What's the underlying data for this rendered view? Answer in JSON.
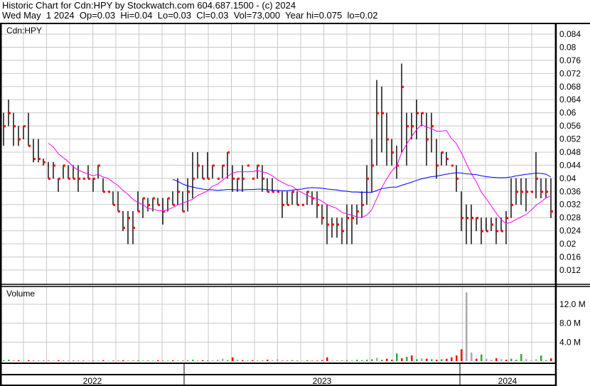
{
  "header": {
    "title": "Historic Chart for Cdn:HPY by Stockwatch.com 604.687.1500 - (c) 2024",
    "summary": "Wed May  1 2024  Op=0.03  Hi=0.04  Lo=0.03  Cl=0.03  Vol=73,000  Year hi=0.075  lo=0.02"
  },
  "colors": {
    "bar": "#000000",
    "close_tick": "#ff0000",
    "ma_short": "#ff00ff",
    "ma_long": "#0000ff",
    "vol_up": "#33aa33",
    "vol_down": "#ff0000",
    "vol_flat": "#aaaaaa",
    "grid": "#c8c8c8"
  },
  "chart_data": [
    {
      "type": "ohlc",
      "title": "Cdn:HPY",
      "y_ticks": [
        "0.084",
        "0.08",
        "0.076",
        "0.072",
        "0.068",
        "0.064",
        "0.06",
        "0.056",
        "0.052",
        "0.048",
        "0.044",
        "0.04",
        "0.036",
        "0.032",
        "0.028",
        "0.024",
        "0.02",
        "0.016",
        "0.012"
      ],
      "ylim": [
        0.0085,
        0.0875
      ],
      "ma_periods": [
        10,
        35
      ],
      "bars_hi_lo_close": [
        [
          0.06,
          0.05,
          0.056
        ],
        [
          0.064,
          0.056,
          0.06
        ],
        [
          0.06,
          0.05,
          0.056
        ],
        [
          0.056,
          0.05,
          0.052
        ],
        [
          0.056,
          0.052,
          0.056
        ],
        [
          0.06,
          0.05,
          0.05
        ],
        [
          0.052,
          0.045,
          0.046
        ],
        [
          0.052,
          0.045,
          0.046
        ],
        [
          0.046,
          0.044,
          0.045
        ],
        [
          0.045,
          0.04,
          0.04
        ],
        [
          0.045,
          0.04,
          0.044
        ],
        [
          0.04,
          0.036,
          0.04
        ],
        [
          0.044,
          0.04,
          0.044
        ],
        [
          0.044,
          0.04,
          0.04
        ],
        [
          0.044,
          0.04,
          0.04
        ],
        [
          0.044,
          0.036,
          0.04
        ],
        [
          0.04,
          0.04,
          0.04
        ],
        [
          0.044,
          0.04,
          0.04
        ],
        [
          0.04,
          0.036,
          0.04
        ],
        [
          0.044,
          0.04,
          0.044
        ],
        [
          0.04,
          0.036,
          0.036
        ],
        [
          0.036,
          0.036,
          0.036
        ],
        [
          0.036,
          0.032,
          0.032
        ],
        [
          0.036,
          0.03,
          0.03
        ],
        [
          0.03,
          0.024,
          0.025
        ],
        [
          0.03,
          0.02,
          0.028
        ],
        [
          0.03,
          0.02,
          0.025
        ],
        [
          0.036,
          0.03,
          0.03
        ],
        [
          0.034,
          0.028,
          0.034
        ],
        [
          0.034,
          0.03,
          0.032
        ],
        [
          0.034,
          0.03,
          0.034
        ],
        [
          0.034,
          0.032,
          0.032
        ],
        [
          0.034,
          0.026,
          0.03
        ],
        [
          0.034,
          0.03,
          0.034
        ],
        [
          0.036,
          0.032,
          0.032
        ],
        [
          0.04,
          0.032,
          0.036
        ],
        [
          0.036,
          0.03,
          0.03
        ],
        [
          0.04,
          0.03,
          0.036
        ],
        [
          0.048,
          0.034,
          0.04
        ],
        [
          0.048,
          0.04,
          0.044
        ],
        [
          0.044,
          0.04,
          0.04
        ],
        [
          0.048,
          0.04,
          0.04
        ],
        [
          0.044,
          0.04,
          0.044
        ],
        [
          0.04,
          0.04,
          0.04
        ],
        [
          0.044,
          0.04,
          0.044
        ],
        [
          0.048,
          0.04,
          0.048
        ],
        [
          0.044,
          0.036,
          0.04
        ],
        [
          0.04,
          0.036,
          0.04
        ],
        [
          0.044,
          0.036,
          0.04
        ],
        [
          0.044,
          0.044,
          0.044
        ],
        [
          0.04,
          0.04,
          0.04
        ],
        [
          0.044,
          0.04,
          0.044
        ],
        [
          0.044,
          0.036,
          0.04
        ],
        [
          0.04,
          0.036,
          0.036
        ],
        [
          0.04,
          0.036,
          0.036
        ],
        [
          0.036,
          0.036,
          0.036
        ],
        [
          0.036,
          0.028,
          0.032
        ],
        [
          0.036,
          0.032,
          0.032
        ],
        [
          0.036,
          0.032,
          0.036
        ],
        [
          0.036,
          0.032,
          0.032
        ],
        [
          0.032,
          0.032,
          0.032
        ],
        [
          0.036,
          0.032,
          0.036
        ],
        [
          0.036,
          0.032,
          0.034
        ],
        [
          0.036,
          0.028,
          0.032
        ],
        [
          0.032,
          0.026,
          0.028
        ],
        [
          0.032,
          0.02,
          0.026
        ],
        [
          0.028,
          0.022,
          0.026
        ],
        [
          0.028,
          0.022,
          0.026
        ],
        [
          0.028,
          0.02,
          0.024
        ],
        [
          0.032,
          0.02,
          0.028
        ],
        [
          0.032,
          0.02,
          0.028
        ],
        [
          0.032,
          0.026,
          0.03
        ],
        [
          0.036,
          0.028,
          0.032
        ],
        [
          0.044,
          0.032,
          0.04
        ],
        [
          0.052,
          0.036,
          0.044
        ],
        [
          0.07,
          0.044,
          0.06
        ],
        [
          0.068,
          0.048,
          0.06
        ],
        [
          0.06,
          0.044,
          0.052
        ],
        [
          0.052,
          0.044,
          0.048
        ],
        [
          0.05,
          0.04,
          0.044
        ],
        [
          0.075,
          0.048,
          0.068
        ],
        [
          0.06,
          0.044,
          0.056
        ],
        [
          0.06,
          0.052,
          0.056
        ],
        [
          0.064,
          0.052,
          0.06
        ],
        [
          0.06,
          0.056,
          0.06
        ],
        [
          0.06,
          0.044,
          0.052
        ],
        [
          0.06,
          0.048,
          0.056
        ],
        [
          0.052,
          0.04,
          0.044
        ],
        [
          0.048,
          0.044,
          0.048
        ],
        [
          0.048,
          0.044,
          0.046
        ],
        [
          0.044,
          0.044,
          0.044
        ],
        [
          0.044,
          0.036,
          0.04
        ],
        [
          0.036,
          0.024,
          0.028
        ],
        [
          0.032,
          0.02,
          0.028
        ],
        [
          0.032,
          0.02,
          0.028
        ],
        [
          0.028,
          0.024,
          0.028
        ],
        [
          0.028,
          0.02,
          0.024
        ],
        [
          0.028,
          0.024,
          0.024
        ],
        [
          0.028,
          0.024,
          0.026
        ],
        [
          0.028,
          0.02,
          0.024
        ],
        [
          0.028,
          0.024,
          0.024
        ],
        [
          0.03,
          0.02,
          0.028
        ],
        [
          0.04,
          0.028,
          0.032
        ],
        [
          0.04,
          0.032,
          0.036
        ],
        [
          0.04,
          0.032,
          0.036
        ],
        [
          0.04,
          0.03,
          0.036
        ],
        [
          0.036,
          0.036,
          0.036
        ],
        [
          0.048,
          0.034,
          0.04
        ],
        [
          0.04,
          0.034,
          0.036
        ],
        [
          0.04,
          0.034,
          0.036
        ],
        [
          0.04,
          0.028,
          0.03
        ]
      ]
    },
    {
      "type": "bar",
      "title": "Volume",
      "y_ticks": [
        "12.0 M",
        "8.0 M",
        "4.0 M"
      ],
      "y_tick_values": [
        12,
        8,
        4
      ],
      "unit": "millions",
      "values": [
        0.2,
        0.3,
        0.1,
        0.2,
        0.1,
        0.2,
        0.1,
        0.2,
        0.1,
        0.1,
        0.1,
        0.2,
        0.1,
        0.1,
        0.1,
        0.2,
        0.1,
        0.1,
        0.1,
        0.1,
        0.2,
        0.1,
        0.1,
        0.1,
        0.2,
        0.1,
        0.1,
        0.2,
        0.1,
        0.1,
        0.1,
        0.2,
        0.1,
        0.1,
        0.2,
        0.1,
        0.1,
        0.2,
        0.3,
        0.1,
        0.2,
        0.1,
        0.1,
        0.3,
        0.5,
        0.2,
        0.8,
        0.3,
        0.2,
        0.1,
        0.2,
        0.1,
        0.1,
        0.3,
        0.2,
        0.4,
        0.1,
        0.1,
        0.2,
        0.1,
        0.1,
        0.2,
        0.1,
        0.1,
        0.2,
        0.8,
        0.1,
        0.2,
        0.1,
        0.2,
        0.2,
        0.3,
        0.2,
        0.3,
        0.4,
        0.7,
        0.3,
        0.5,
        0.3,
        1.6,
        0.6,
        0.9,
        1.2,
        0.4,
        0.6,
        0.5,
        0.4,
        0.3,
        0.4,
        0.5,
        0.8,
        1.2,
        2.5,
        14.5,
        1.8,
        0.5,
        1.4,
        0.5,
        0.3,
        0.6,
        0.4,
        0.3,
        0.5,
        0.3,
        1.5,
        0.4,
        0.2,
        0.4,
        1.2,
        0.3,
        0.6
      ],
      "directions": [
        "u",
        "u",
        "d",
        "d",
        "f",
        "d",
        "d",
        "f",
        "d",
        "d",
        "f",
        "d",
        "d",
        "u",
        "d",
        "f",
        "d",
        "f",
        "d",
        "u",
        "d",
        "f",
        "d",
        "d",
        "d",
        "u",
        "d",
        "u",
        "u",
        "d",
        "u",
        "d",
        "d",
        "u",
        "d",
        "u",
        "d",
        "u",
        "u",
        "u",
        "d",
        "d",
        "u",
        "f",
        "f",
        "u",
        "d",
        "f",
        "d",
        "u",
        "d",
        "u",
        "d",
        "d",
        "f",
        "f",
        "d",
        "d",
        "u",
        "d",
        "f",
        "u",
        "d",
        "d",
        "d",
        "d",
        "f",
        "f",
        "d",
        "u",
        "f",
        "u",
        "u",
        "u",
        "u",
        "f",
        "u",
        "d",
        "d",
        "u",
        "d",
        "u",
        "d",
        "u",
        "f",
        "d",
        "u",
        "d",
        "u",
        "d",
        "d",
        "d",
        "d",
        "f",
        "f",
        "d",
        "u",
        "f",
        "f",
        "d",
        "f",
        "d",
        "u",
        "u",
        "u",
        "f",
        "f",
        "f",
        "u",
        "f",
        "d"
      ]
    }
  ],
  "x_axis": {
    "years": [
      "2022",
      "2023",
      "2024"
    ]
  }
}
